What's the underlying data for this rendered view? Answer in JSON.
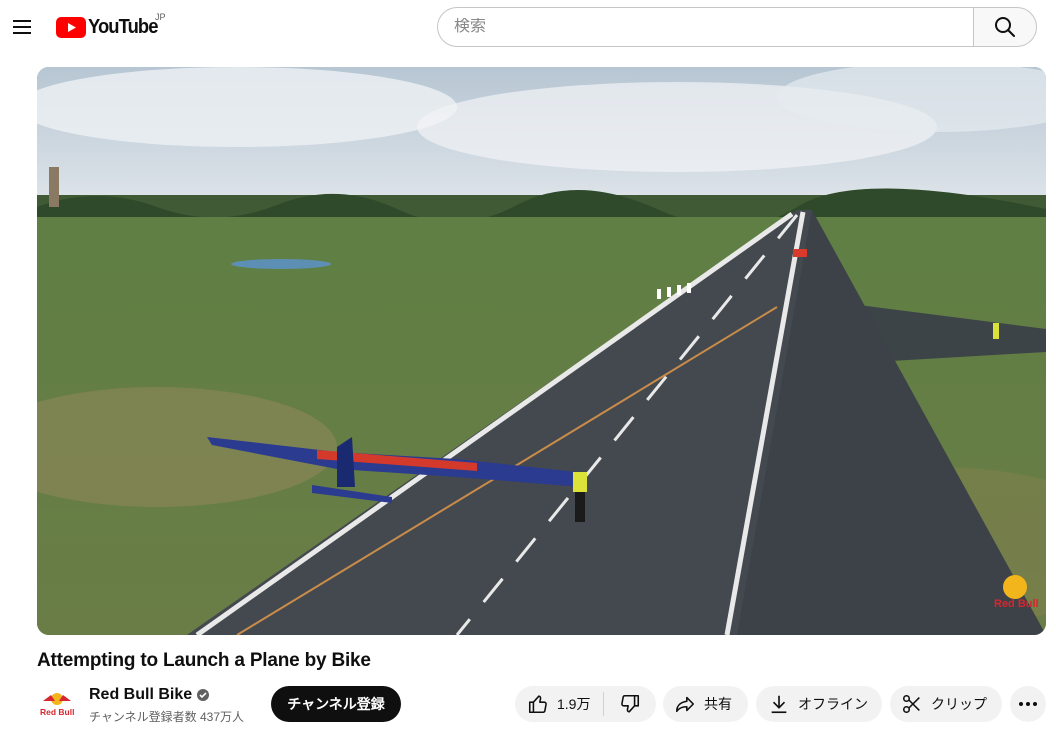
{
  "masthead": {
    "logo_text": "YouTube",
    "country_code": "JP",
    "search_placeholder": "検索"
  },
  "video": {
    "title": "Attempting to Launch a Plane by Bike",
    "watermark": "Red Bull"
  },
  "channel": {
    "name": "Red Bull Bike",
    "subscribers": "チャンネル登録者数 437万人",
    "avatar_text": "Red Bull",
    "verified": true
  },
  "actions": {
    "subscribe_label": "チャンネル登録",
    "like_count": "1.9万",
    "share_label": "共有",
    "download_label": "オフライン",
    "clip_label": "クリップ"
  },
  "colors": {
    "brand_red": "#ff0000",
    "subscribe_bg": "#0f0f0f",
    "pill_bg": "#f2f2f2"
  }
}
